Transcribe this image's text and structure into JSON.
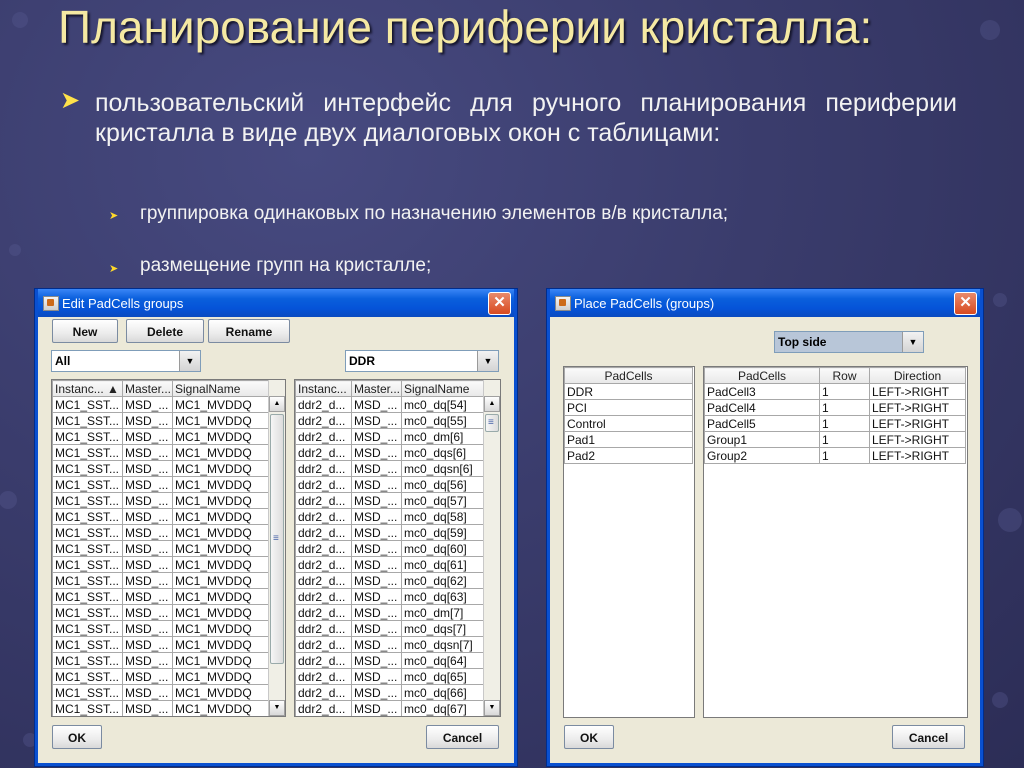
{
  "slide": {
    "title": "Планирование периферии кристалла:",
    "bullet_main": "пользовательский интерфейс для ручного планирования периферии кристалла в виде двух диалоговых окон с таблицами:",
    "sub_bullets": [
      "группировка одинаковых по назначению элементов в/в кристалла;",
      "размещение групп на кристалле;"
    ]
  },
  "edit_dialog": {
    "title": "Edit PadCells groups",
    "buttons": {
      "new": "New",
      "delete": "Delete",
      "rename": "Rename",
      "ok": "OK",
      "cancel": "Cancel"
    },
    "left_combo": "All",
    "right_combo": "DDR",
    "left_table": {
      "headers": [
        "Instanc... ▲",
        "Master...",
        "SignalName"
      ],
      "rows": [
        [
          "MC1_SST...",
          "MSD_...",
          "MC1_MVDDQ"
        ],
        [
          "MC1_SST...",
          "MSD_...",
          "MC1_MVDDQ"
        ],
        [
          "MC1_SST...",
          "MSD_...",
          "MC1_MVDDQ"
        ],
        [
          "MC1_SST...",
          "MSD_...",
          "MC1_MVDDQ"
        ],
        [
          "MC1_SST...",
          "MSD_...",
          "MC1_MVDDQ"
        ],
        [
          "MC1_SST...",
          "MSD_...",
          "MC1_MVDDQ"
        ],
        [
          "MC1_SST...",
          "MSD_...",
          "MC1_MVDDQ"
        ],
        [
          "MC1_SST...",
          "MSD_...",
          "MC1_MVDDQ"
        ],
        [
          "MC1_SST...",
          "MSD_...",
          "MC1_MVDDQ"
        ],
        [
          "MC1_SST...",
          "MSD_...",
          "MC1_MVDDQ"
        ],
        [
          "MC1_SST...",
          "MSD_...",
          "MC1_MVDDQ"
        ],
        [
          "MC1_SST...",
          "MSD_...",
          "MC1_MVDDQ"
        ],
        [
          "MC1_SST...",
          "MSD_...",
          "MC1_MVDDQ"
        ],
        [
          "MC1_SST...",
          "MSD_...",
          "MC1_MVDDQ"
        ],
        [
          "MC1_SST...",
          "MSD_...",
          "MC1_MVDDQ"
        ],
        [
          "MC1_SST...",
          "MSD_...",
          "MC1_MVDDQ"
        ],
        [
          "MC1_SST...",
          "MSD_...",
          "MC1_MVDDQ"
        ],
        [
          "MC1_SST...",
          "MSD_...",
          "MC1_MVDDQ"
        ],
        [
          "MC1_SST...",
          "MSD_...",
          "MC1_MVDDQ"
        ],
        [
          "MC1_SST...",
          "MSD_...",
          "MC1_MVDDQ"
        ]
      ]
    },
    "right_table": {
      "headers": [
        "Instanc...",
        "Master...",
        "SignalName"
      ],
      "rows": [
        [
          "ddr2_d...",
          "MSD_...",
          "mc0_dq[54]"
        ],
        [
          "ddr2_d...",
          "MSD_...",
          "mc0_dq[55]"
        ],
        [
          "ddr2_d...",
          "MSD_...",
          "mc0_dm[6]"
        ],
        [
          "ddr2_d...",
          "MSD_...",
          "mc0_dqs[6]"
        ],
        [
          "ddr2_d...",
          "MSD_...",
          "mc0_dqsn[6]"
        ],
        [
          "ddr2_d...",
          "MSD_...",
          "mc0_dq[56]"
        ],
        [
          "ddr2_d...",
          "MSD_...",
          "mc0_dq[57]"
        ],
        [
          "ddr2_d...",
          "MSD_...",
          "mc0_dq[58]"
        ],
        [
          "ddr2_d...",
          "MSD_...",
          "mc0_dq[59]"
        ],
        [
          "ddr2_d...",
          "MSD_...",
          "mc0_dq[60]"
        ],
        [
          "ddr2_d...",
          "MSD_...",
          "mc0_dq[61]"
        ],
        [
          "ddr2_d...",
          "MSD_...",
          "mc0_dq[62]"
        ],
        [
          "ddr2_d...",
          "MSD_...",
          "mc0_dq[63]"
        ],
        [
          "ddr2_d...",
          "MSD_...",
          "mc0_dm[7]"
        ],
        [
          "ddr2_d...",
          "MSD_...",
          "mc0_dqs[7]"
        ],
        [
          "ddr2_d...",
          "MSD_...",
          "mc0_dqsn[7]"
        ],
        [
          "ddr2_d...",
          "MSD_...",
          "mc0_dq[64]"
        ],
        [
          "ddr2_d...",
          "MSD_...",
          "mc0_dq[65]"
        ],
        [
          "ddr2_d...",
          "MSD_...",
          "mc0_dq[66]"
        ],
        [
          "ddr2_d...",
          "MSD_...",
          "mc0_dq[67]"
        ]
      ]
    }
  },
  "place_dialog": {
    "title": "Place PadCells (groups)",
    "combo": "Top side",
    "buttons": {
      "ok": "OK",
      "cancel": "Cancel"
    },
    "left_table": {
      "headers": [
        "PadCells"
      ],
      "rows": [
        [
          "DDR"
        ],
        [
          "PCI"
        ],
        [
          "Control"
        ],
        [
          "Pad1"
        ],
        [
          "Pad2"
        ]
      ]
    },
    "right_table": {
      "headers": [
        "PadCells",
        "Row",
        "Direction"
      ],
      "rows": [
        [
          "PadCell3",
          "1",
          "LEFT->RIGHT"
        ],
        [
          "PadCell4",
          "1",
          "LEFT->RIGHT"
        ],
        [
          "PadCell5",
          "1",
          "LEFT->RIGHT"
        ],
        [
          "Group1",
          "1",
          "LEFT->RIGHT"
        ],
        [
          "Group2",
          "1",
          "LEFT->RIGHT"
        ]
      ]
    }
  }
}
